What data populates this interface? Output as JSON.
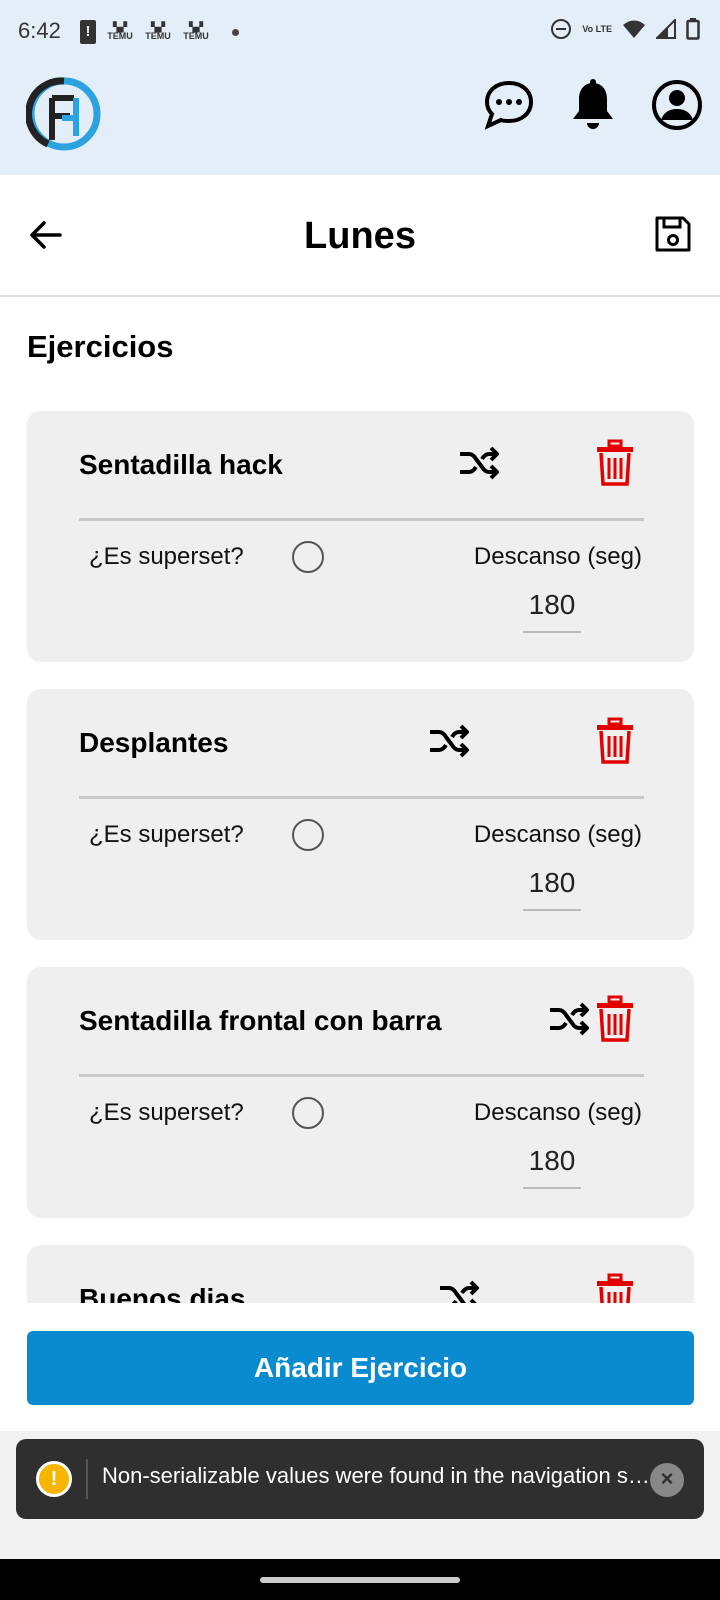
{
  "status_bar": {
    "time": "6:42",
    "temu_labels": [
      "TEMU",
      "TEMU",
      "TEMU"
    ],
    "network_label": "Vo LTE"
  },
  "header": {
    "logo_letters": "FH",
    "icons": [
      "chat-icon",
      "bell-icon",
      "account-icon"
    ]
  },
  "title_bar": {
    "title": "Lunes"
  },
  "section_title": "Ejercicios",
  "exercises": [
    {
      "name": "Sentadilla hack",
      "superset_label": "¿Es superset?",
      "rest_label": "Descanso (seg)",
      "rest_value": "180"
    },
    {
      "name": "Desplantes",
      "superset_label": "¿Es superset?",
      "rest_label": "Descanso (seg)",
      "rest_value": "180"
    },
    {
      "name": "Sentadilla frontal con barra",
      "superset_label": "¿Es superset?",
      "rest_label": "Descanso (seg)",
      "rest_value": "180"
    },
    {
      "name": "Buenos dias"
    }
  ],
  "add_button_label": "Añadir Ejercicio",
  "toast": {
    "icon": "!",
    "message": "Non-serializable values were found in the navigation state",
    "close": "×"
  },
  "colors": {
    "accent": "#0a8bd0",
    "trash": "#e30000",
    "header_bg": "#e4eef8"
  }
}
